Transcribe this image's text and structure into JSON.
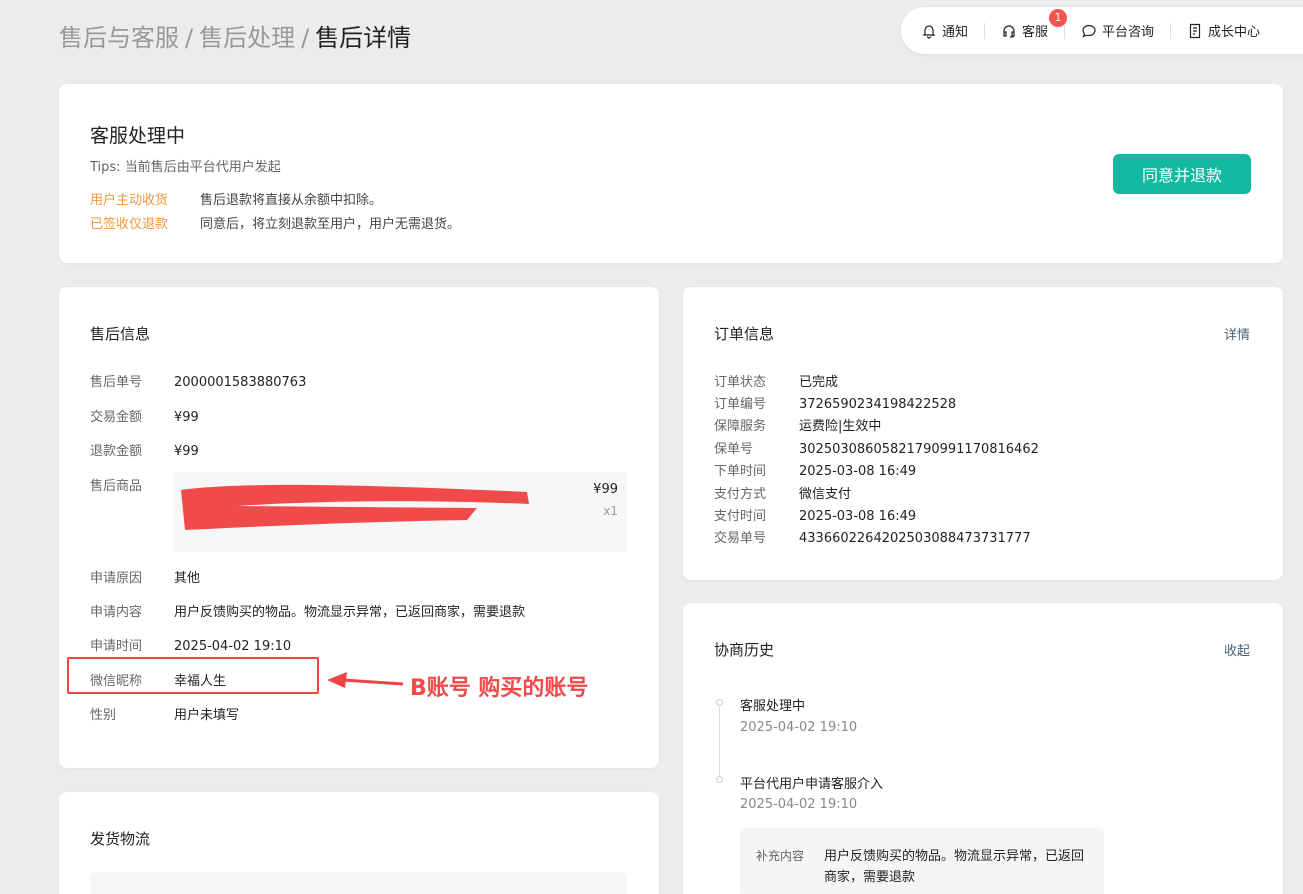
{
  "breadcrumb": {
    "level1": "售后与客服",
    "level2": "售后处理",
    "current": "售后详情",
    "separator": "/"
  },
  "topnav": {
    "notify_label": "通知",
    "service_label": "客服",
    "service_badge": "1",
    "consult_label": "平台咨询",
    "growth_label": "成长中心"
  },
  "status": {
    "title": "客服处理中",
    "tips": "Tips: 当前售后由平台代用户发起",
    "rows": [
      {
        "tag": "用户主动收货",
        "desc": "售后退款将直接从余额中扣除。"
      },
      {
        "tag": "已签收仅退款",
        "desc": "同意后，将立刻退款至用户，用户无需退货。"
      }
    ],
    "agree_button": "同意并退款"
  },
  "aftersale": {
    "title": "售后信息",
    "order_no_label": "售后单号",
    "order_no": "2000001583880763",
    "trade_amount_label": "交易金额",
    "trade_amount": "¥99",
    "refund_amount_label": "退款金额",
    "refund_amount": "¥99",
    "product_label": "售后商品",
    "product_price": "¥99",
    "product_qty": "x1",
    "reason_label": "申请原因",
    "reason": "其他",
    "content_label": "申请内容",
    "content": "用户反馈购买的物品。物流显示异常，已返回商家，需要退款",
    "time_label": "申请时间",
    "time": "2025-04-02 19:10",
    "nickname_label": "微信昵称",
    "nickname": "幸福人生",
    "gender_label": "性别",
    "gender": "用户未填写"
  },
  "annotation": {
    "text": "B账号 购买的账号"
  },
  "logistics": {
    "title": "发货物流"
  },
  "order": {
    "title": "订单信息",
    "detail_link": "详情",
    "rows": [
      {
        "k": "订单状态",
        "v": "已完成"
      },
      {
        "k": "订单编号",
        "v": "3726590234198422528"
      },
      {
        "k": "保障服务",
        "v": "运费险|生效中"
      },
      {
        "k": "保单号",
        "v": "30250308605821790991170816462"
      },
      {
        "k": "下单时间",
        "v": "2025-03-08 16:49"
      },
      {
        "k": "支付方式",
        "v": "微信支付"
      },
      {
        "k": "支付时间",
        "v": "2025-03-08 16:49"
      },
      {
        "k": "交易单号",
        "v": "4336602264202503088473731777"
      }
    ]
  },
  "history": {
    "title": "协商历史",
    "collapse_link": "收起",
    "events": [
      {
        "title": "客服处理中",
        "time": "2025-04-02 19:10"
      },
      {
        "title": "平台代用户申请客服介入",
        "time": "2025-04-02 19:10"
      }
    ],
    "supplement_label": "补充内容",
    "supplement_text": "用户反馈购买的物品。物流显示异常，已返回商家，需要退款"
  },
  "colors": {
    "accent": "#13b8a3",
    "warning": "#f0983a",
    "annotation_red": "#f04343"
  }
}
